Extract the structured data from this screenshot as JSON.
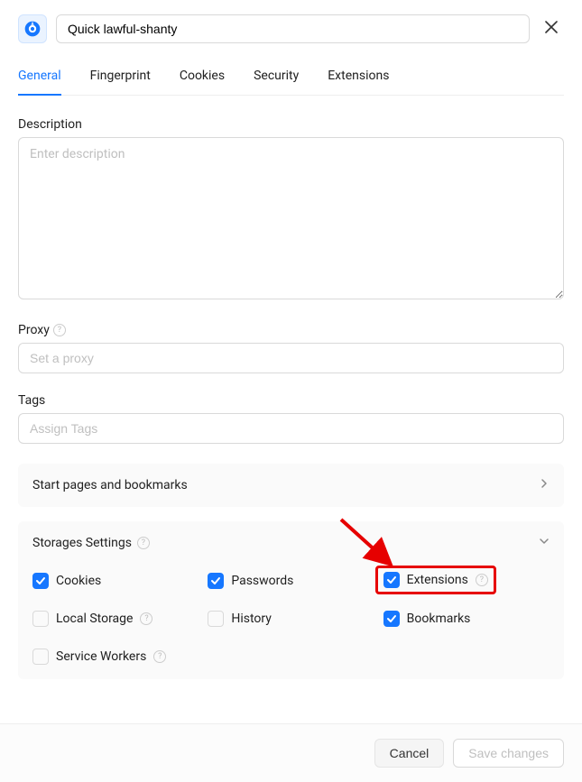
{
  "header": {
    "profile_name": "Quick lawful-shanty"
  },
  "tabs": {
    "general": "General",
    "fingerprint": "Fingerprint",
    "cookies": "Cookies",
    "security": "Security",
    "extensions": "Extensions",
    "active": "general"
  },
  "fields": {
    "description_label": "Description",
    "description_placeholder": "Enter description",
    "proxy_label": "Proxy",
    "proxy_placeholder": "Set a proxy",
    "tags_label": "Tags",
    "tags_placeholder": "Assign Tags"
  },
  "panels": {
    "start_pages_label": "Start pages and bookmarks",
    "storages_label": "Storages Settings"
  },
  "storages": {
    "cookies": {
      "label": "Cookies",
      "checked": true
    },
    "passwords": {
      "label": "Passwords",
      "checked": true
    },
    "extensions": {
      "label": "Extensions",
      "checked": true
    },
    "local_storage": {
      "label": "Local Storage",
      "checked": false
    },
    "history": {
      "label": "History",
      "checked": false
    },
    "bookmarks": {
      "label": "Bookmarks",
      "checked": true
    },
    "service_workers": {
      "label": "Service Workers",
      "checked": false
    }
  },
  "footer": {
    "cancel": "Cancel",
    "save": "Save changes"
  }
}
